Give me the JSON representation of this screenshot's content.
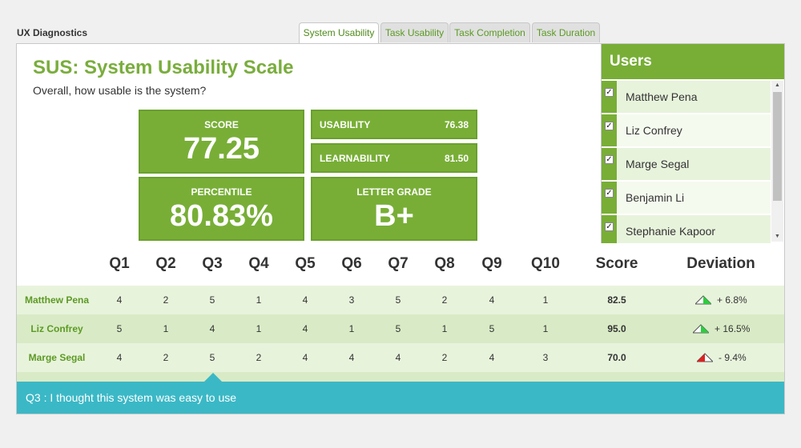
{
  "app": {
    "title": "UX Diagnostics"
  },
  "tabs": [
    {
      "label": "System Usability",
      "active": true
    },
    {
      "label": "Task Usability"
    },
    {
      "label": "Task Completion"
    },
    {
      "label": "Task Duration"
    }
  ],
  "sus": {
    "title": "SUS: System Usability Scale",
    "subtitle": "Overall, how usable is the system?",
    "score_label": "SCORE",
    "score_value": "77.25",
    "percentile_label": "PERCENTILE",
    "percentile_value": "80.83%",
    "usability_label": "USABILITY",
    "usability_value": "76.38",
    "learnability_label": "LEARNABILITY",
    "learnability_value": "81.50",
    "grade_label": "LETTER GRADE",
    "grade_value": "B+"
  },
  "users": {
    "title": "Users",
    "items": [
      {
        "name": "Matthew Pena",
        "checked": true
      },
      {
        "name": "Liz Confrey",
        "checked": true
      },
      {
        "name": "Marge Segal",
        "checked": true
      },
      {
        "name": "Benjamin Li",
        "checked": true
      },
      {
        "name": "Stephanie Kapoor",
        "checked": true
      }
    ]
  },
  "table": {
    "headers": [
      "Q1",
      "Q2",
      "Q3",
      "Q4",
      "Q5",
      "Q6",
      "Q7",
      "Q8",
      "Q9",
      "Q10",
      "Score",
      "Deviation"
    ],
    "rows": [
      {
        "name": "Matthew Pena",
        "answers": [
          "4",
          "2",
          "5",
          "1",
          "4",
          "3",
          "5",
          "2",
          "4",
          "1"
        ],
        "score": "82.5",
        "deviation": "+ 6.8%",
        "trend": "up"
      },
      {
        "name": "Liz Confrey",
        "answers": [
          "5",
          "1",
          "4",
          "1",
          "4",
          "1",
          "5",
          "1",
          "5",
          "1"
        ],
        "score": "95.0",
        "deviation": "+ 16.5%",
        "trend": "up"
      },
      {
        "name": "Marge Segal",
        "answers": [
          "4",
          "2",
          "5",
          "2",
          "4",
          "4",
          "4",
          "2",
          "4",
          "3"
        ],
        "score": "70.0",
        "deviation": "- 9.4%",
        "trend": "down"
      }
    ]
  },
  "tooltip": {
    "text": "Q3 : I thought this system was easy to use"
  },
  "colors": {
    "brand_green": "#78ae36",
    "accent_teal": "#3bb8c6",
    "trend_up": "#2ecc40",
    "trend_down": "#e02020"
  }
}
